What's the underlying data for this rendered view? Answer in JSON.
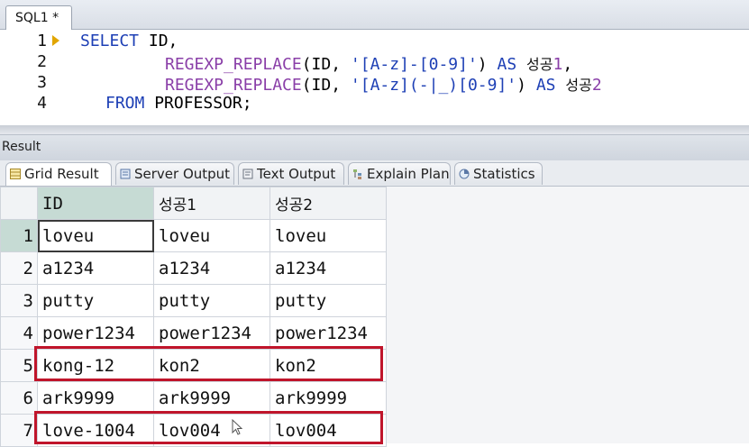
{
  "editor_tab": {
    "label": "SQL1 *"
  },
  "editor": {
    "line_numbers": [
      "1",
      "2",
      "3",
      "4"
    ],
    "line1": {
      "kw": "SELECT",
      "rest": " ID,"
    },
    "line2": {
      "fn": "REGEXP_REPLACE",
      "open": "(ID, ",
      "pattern": "'[A-z]-[0-9]'",
      "close": ") ",
      "as": "AS",
      "alias_kr": "성공",
      "alias_num": "1",
      "tail": ","
    },
    "line3": {
      "fn": "REGEXP_REPLACE",
      "open": "(ID, ",
      "pattern": "'[A-z](-|_)[0-9]'",
      "close": ") ",
      "as": "AS",
      "alias_kr": "성공",
      "alias_num": "2"
    },
    "line4": {
      "kw": "FROM",
      "rest": " PROFESSOR;"
    }
  },
  "result_panel": {
    "title": "Result"
  },
  "subtabs": [
    {
      "label": "Grid Result",
      "icon": "grid-icon"
    },
    {
      "label": "Server Output",
      "icon": "server-output-icon"
    },
    {
      "label": "Text Output",
      "icon": "text-output-icon"
    },
    {
      "label": "Explain Plan",
      "icon": "explain-plan-icon"
    },
    {
      "label": "Statistics",
      "icon": "statistics-icon"
    }
  ],
  "grid": {
    "columns": [
      "ID",
      "성공1",
      "성공2"
    ],
    "rows": [
      {
        "n": "1",
        "cells": [
          "loveu",
          "loveu",
          "loveu"
        ]
      },
      {
        "n": "2",
        "cells": [
          "a1234",
          "a1234",
          "a1234"
        ]
      },
      {
        "n": "3",
        "cells": [
          "putty",
          "putty",
          "putty"
        ]
      },
      {
        "n": "4",
        "cells": [
          "power1234",
          "power1234",
          "power1234"
        ]
      },
      {
        "n": "5",
        "cells": [
          "kong-12",
          "kon2",
          "kon2"
        ]
      },
      {
        "n": "6",
        "cells": [
          "ark9999",
          "ark9999",
          "ark9999"
        ]
      },
      {
        "n": "7",
        "cells": [
          "love-1004",
          "lov004",
          "lov004"
        ]
      }
    ],
    "highlight_color": "#c0152b",
    "header_id_color": "#c6dbd4"
  }
}
